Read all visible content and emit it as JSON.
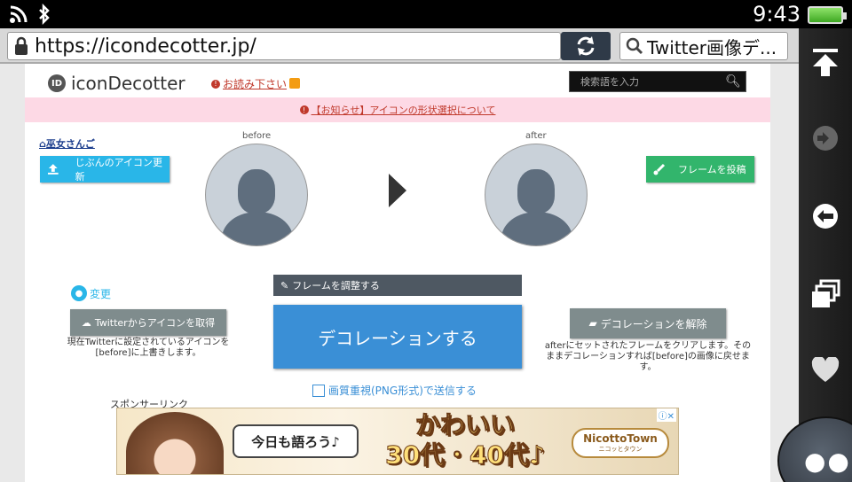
{
  "status": {
    "time": "9:43"
  },
  "browser": {
    "url": "https://icondecotter.jp/",
    "search_text": "Twitter画像デ..."
  },
  "site": {
    "logo_badge": "ID",
    "logo_text": "iconDecotter",
    "read_link": "お読み下さい",
    "search_placeholder": "検索語を入力",
    "notice": "【お知らせ】アイコンの形状選択について",
    "home_link": "巫女さんご",
    "upload_button": "じぶんのアイコン更新",
    "frame_button": "フレームを投稿",
    "before_label": "before",
    "after_label": "after",
    "change_link": "変更",
    "twitter_button": "Twitterからアイコンを取得",
    "twitter_desc": "現在Twitterに設定されているアイコンを[before]に上書きします。",
    "adjust_frame": "フレームを調整する",
    "decorate_button": "デコレーションする",
    "release_button": "デコレーションを解除",
    "release_desc": "afterにセットされたフレームをクリアします。そのままデコレーションすれば[before]の画像に戻せます。",
    "png_option": "画質重視(PNG形式)で送信する",
    "sponsor_label": "スポンサーリンク"
  },
  "ad": {
    "bubble": "今日も語ろう♪",
    "line1": "かわいい",
    "line2": "30代・40代♪",
    "logo_main": "NicottoTown",
    "logo_sub": "ニコッとタウン"
  },
  "colors": {
    "accent_blue": "#3a8fd6",
    "upload_cyan": "#29b6e8",
    "frame_green": "#32b56c",
    "notice_pink": "#fdd9e5"
  }
}
